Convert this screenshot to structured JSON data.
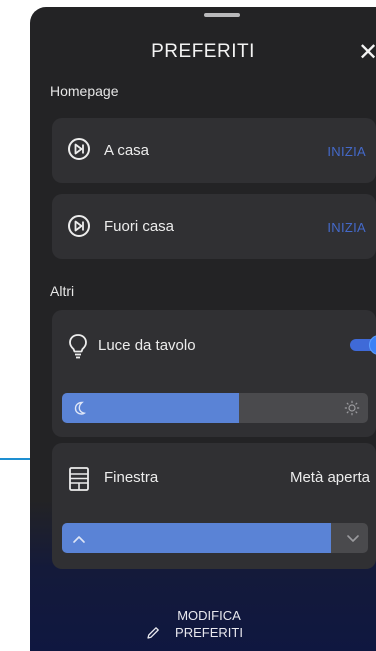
{
  "header": {
    "title": "PREFERITI",
    "close_icon": "close-icon",
    "close_glyph": "✕"
  },
  "homepage": {
    "section_label": "Homepage",
    "items": [
      {
        "label": "A casa",
        "action": "INIZIA",
        "icon": "play-scene-icon"
      },
      {
        "label": "Fuori casa",
        "action": "INIZIA",
        "icon": "play-scene-icon"
      }
    ]
  },
  "altri": {
    "section_label": "Altri",
    "lamp": {
      "label": "Luce da tavolo",
      "icon": "lightbulb-icon",
      "toggle_on": true,
      "brightness_fraction": 0.58,
      "slider_left_icon": "moon-icon",
      "slider_right_icon": "sun-icon"
    },
    "window": {
      "label": "Finestra",
      "status": "Metà aperta",
      "icon": "window-icon",
      "open_fraction": 0.88,
      "up_icon": "chevron-up-icon",
      "down_icon": "chevron-down-icon"
    }
  },
  "footer": {
    "edit_line1": "MODIFICA",
    "edit_line2": "PREFERITI",
    "edit_icon": "pencil-icon"
  },
  "colors": {
    "panel_bg": "#232325",
    "card_bg": "#303033",
    "accent_blue": "#5a83d6",
    "action_text": "#4469c9",
    "callout": "#1e8fd1"
  }
}
